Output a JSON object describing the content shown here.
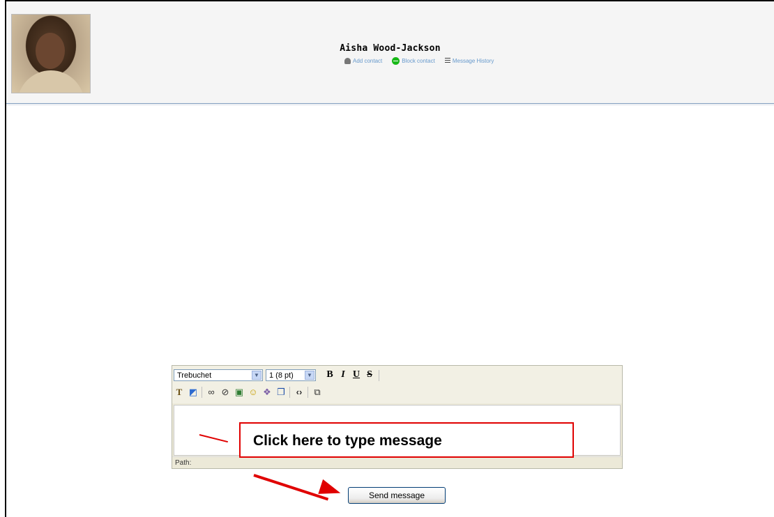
{
  "header": {
    "contact_name": "Aisha Wood-Jackson",
    "actions": [
      {
        "label": "Add contact",
        "icon": "person-icon"
      },
      {
        "label": "Block contact",
        "icon": "block-icon"
      },
      {
        "label": "Message History",
        "icon": "history-icon"
      }
    ]
  },
  "editor": {
    "font_select": "Trebuchet",
    "size_select": "1 (8 pt)",
    "format_buttons": {
      "bold": "B",
      "italic": "I",
      "underline": "U",
      "strike": "S"
    },
    "path_label": "Path:"
  },
  "annotation": {
    "callout_text": "Click here to type message",
    "accent_color": "#e00000"
  },
  "send_button_label": "Send message"
}
